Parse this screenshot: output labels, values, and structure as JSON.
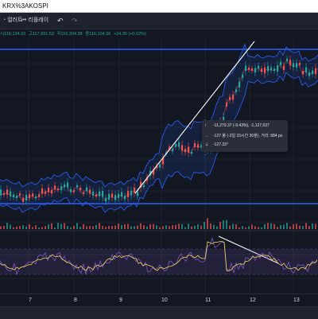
{
  "window": {
    "title": "KRX%3AKOSPI"
  },
  "toolbar": {
    "alert_label": "얼러트",
    "replay_label": "리플레이",
    "undo_glyph": "↶",
    "redo_glyph": "↷",
    "alert_icon": "alarm-clock-icon",
    "replay_icon": "replay-icon"
  },
  "legend": {
    "open": "시118,134.32",
    "high": "고117,991.53",
    "low": "저116,304.38",
    "close": "종116,104.36",
    "change": "+24.35 (+0.02%)"
  },
  "tooltip": {
    "price_range": "-11,270.37 (-9.43%), -1,127,037",
    "bars_range": "-127 봉 (-2일 15시간 30분), 거리: 584 px",
    "angle": "-127.33°"
  },
  "time_axis": {
    "labels": [
      "7",
      "8",
      "9",
      "10",
      "11",
      "12",
      "13"
    ]
  },
  "colors": {
    "background": "#131722",
    "up": "#26a69a",
    "down": "#ef5350",
    "bollinger": "#2962ff",
    "oscillator": "#7e57c2",
    "signal": "#f2d55c",
    "trendline": "#ffffff"
  }
}
